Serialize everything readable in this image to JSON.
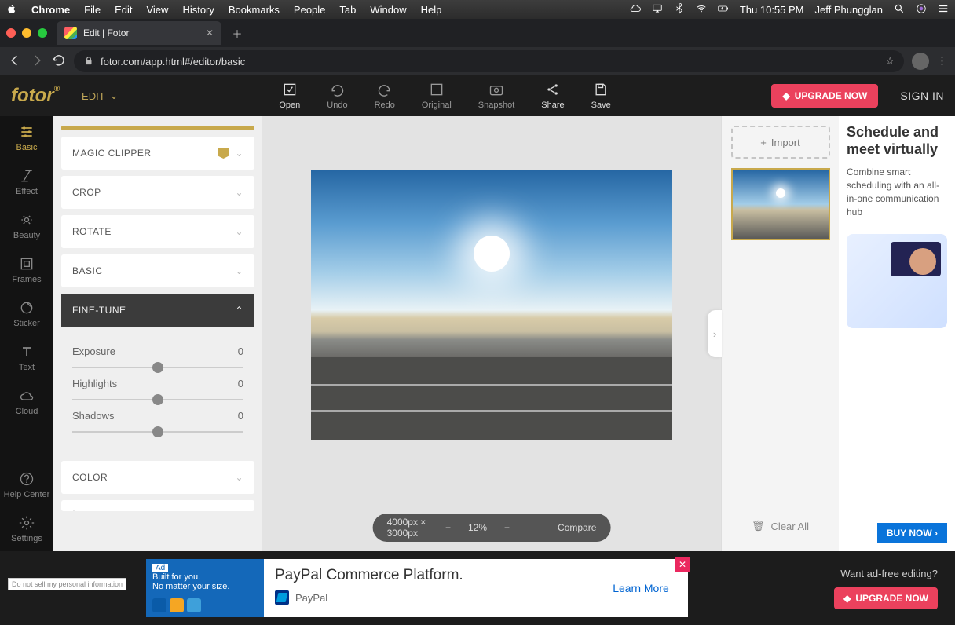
{
  "menubar": {
    "app": "Chrome",
    "items": [
      "File",
      "Edit",
      "View",
      "History",
      "Bookmarks",
      "People",
      "Tab",
      "Window",
      "Help"
    ],
    "time": "Thu 10:55 PM",
    "user": "Jeff Phungglan"
  },
  "browser": {
    "tab_title": "Edit | Fotor",
    "url": "fotor.com/app.html#/editor/basic"
  },
  "fotor": {
    "logo": "fotor",
    "edit_menu": "EDIT",
    "toolbar": {
      "open": "Open",
      "undo": "Undo",
      "redo": "Redo",
      "original": "Original",
      "snapshot": "Snapshot",
      "share": "Share",
      "save": "Save"
    },
    "upgrade": "UPGRADE NOW",
    "signin": "SIGN IN"
  },
  "rail": [
    {
      "label": "Basic"
    },
    {
      "label": "Effect"
    },
    {
      "label": "Beauty"
    },
    {
      "label": "Frames"
    },
    {
      "label": "Sticker"
    },
    {
      "label": "Text"
    },
    {
      "label": "Cloud"
    },
    {
      "label": "Help Center"
    },
    {
      "label": "Settings"
    }
  ],
  "panel": {
    "sections": [
      "MAGIC CLIPPER",
      "CROP",
      "ROTATE",
      "BASIC",
      "FINE-TUNE",
      "COLOR"
    ],
    "sliders": [
      {
        "label": "Exposure",
        "value": "0"
      },
      {
        "label": "Highlights",
        "value": "0"
      },
      {
        "label": "Shadows",
        "value": "0"
      }
    ]
  },
  "canvas": {
    "dims": "4000px × 3000px",
    "zoom": "12%",
    "compare": "Compare"
  },
  "right": {
    "import": "Import",
    "clear": "Clear All"
  },
  "ad_side": {
    "title": "Schedule and meet virtually",
    "copy": "Combine smart scheduling with an all-in-one communication hub",
    "cta": "BUY NOW"
  },
  "ad_bottom": {
    "adlabel": "Ad",
    "l1": "Built for you.",
    "l2": "No matter your size.",
    "pp_title": "PayPal Commerce Platform.",
    "pp_name": "PayPal",
    "learn": "Learn More"
  },
  "footer": {
    "adfree": "Want ad-free editing?",
    "upgrade": "UPGRADE NOW",
    "privacy": "Do not sell my personal information"
  }
}
